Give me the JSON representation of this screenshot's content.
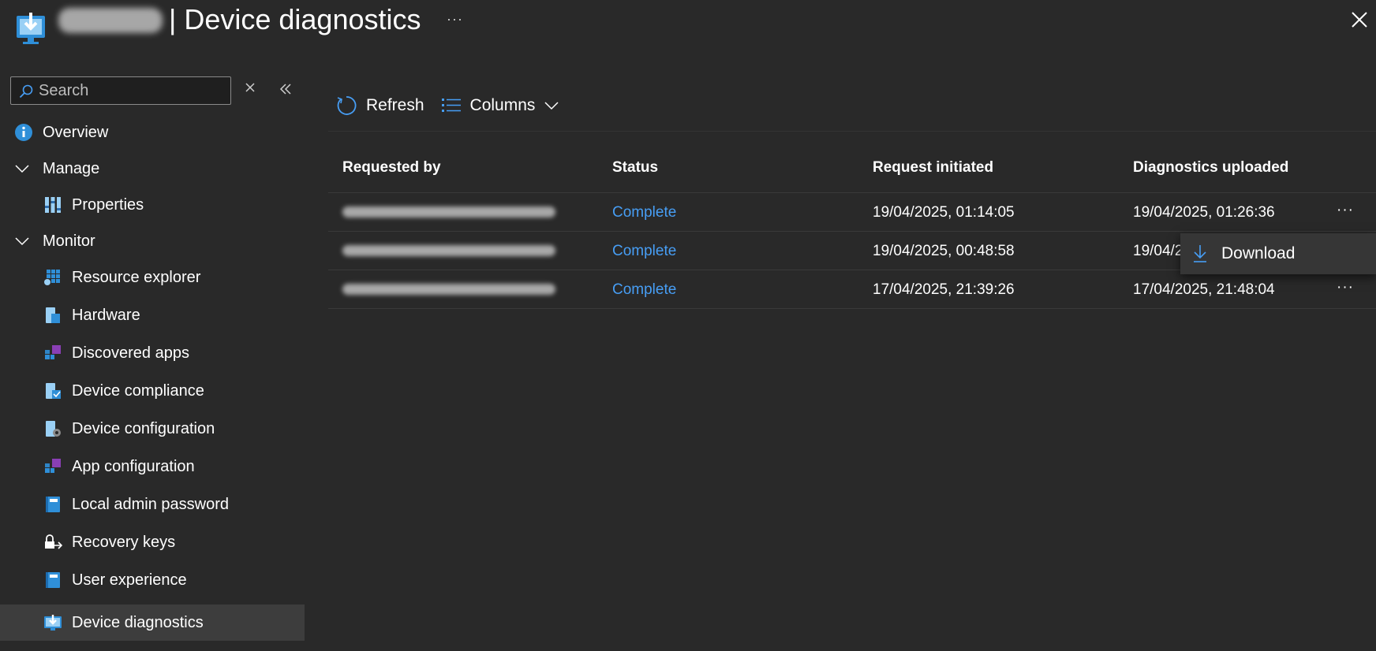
{
  "header": {
    "title": "| Device diagnostics",
    "more_label": "···",
    "close_label": "Close"
  },
  "sidebar": {
    "search_placeholder": "Search",
    "items": [
      {
        "label": "Overview",
        "icon": "info-icon"
      },
      {
        "label": "Manage",
        "icon": "chevron-down-icon"
      },
      {
        "label": "Properties",
        "icon": "properties-icon"
      },
      {
        "label": "Monitor",
        "icon": "chevron-down-icon"
      },
      {
        "label": "Resource explorer",
        "icon": "resource-explorer-icon"
      },
      {
        "label": "Hardware",
        "icon": "hardware-icon"
      },
      {
        "label": "Discovered apps",
        "icon": "apps-icon"
      },
      {
        "label": "Device compliance",
        "icon": "compliance-icon"
      },
      {
        "label": "Device configuration",
        "icon": "configuration-icon"
      },
      {
        "label": "App configuration",
        "icon": "apps-icon"
      },
      {
        "label": "Local admin password",
        "icon": "notebook-icon"
      },
      {
        "label": "Recovery keys",
        "icon": "lock-arrow-icon"
      },
      {
        "label": "User experience",
        "icon": "notebook-icon"
      },
      {
        "label": "Device diagnostics",
        "icon": "diagnostics-icon"
      }
    ]
  },
  "toolbar": {
    "refresh_label": "Refresh",
    "columns_label": "Columns"
  },
  "table": {
    "columns": [
      "Requested by",
      "Status",
      "Request initiated",
      "Diagnostics uploaded"
    ],
    "rows": [
      {
        "status": "Complete",
        "initiated": "19/04/2025, 01:14:05",
        "uploaded": "19/04/2025, 01:26:36"
      },
      {
        "status": "Complete",
        "initiated": "19/04/2025, 00:48:58",
        "uploaded": "19/04/2"
      },
      {
        "status": "Complete",
        "initiated": "17/04/2025, 21:39:26",
        "uploaded": "17/04/2025, 21:48:04"
      }
    ],
    "row_more_label": "···"
  },
  "context_menu": {
    "download_label": "Download"
  },
  "colors": {
    "background": "#292929",
    "accent": "#479ef5",
    "active_nav": "#3d3d3d"
  }
}
